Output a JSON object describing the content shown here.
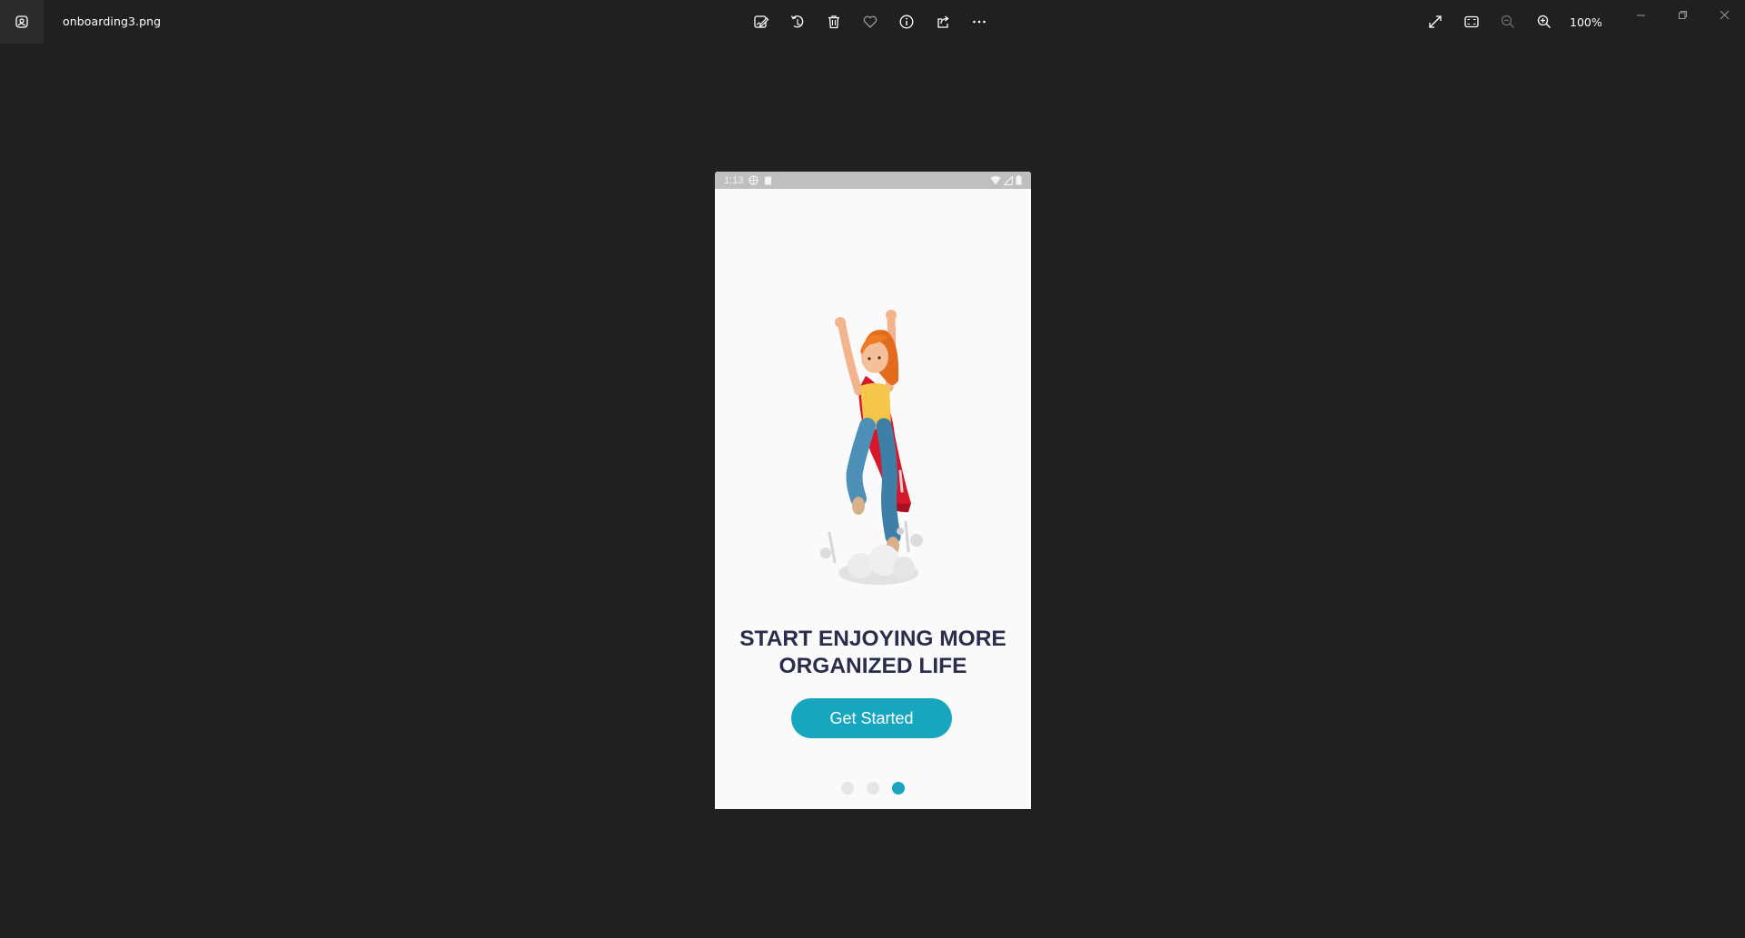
{
  "window": {
    "file_name": "onboarding3.png",
    "zoom_level": "100%"
  },
  "toolbar": {
    "center_icons": [
      "edit-image-icon",
      "rotate-icon",
      "delete-icon",
      "favorite-heart-icon",
      "info-icon",
      "share-icon",
      "more-options-icon"
    ],
    "right_icons": [
      "full-screen-icon",
      "fit-to-window-icon",
      "zoom-out-icon",
      "zoom-in-icon"
    ]
  },
  "phone": {
    "status_bar": {
      "time": "1:13"
    },
    "headline_line1": "START ENJOYING MORE",
    "headline_line2": "ORGANIZED LIFE",
    "cta_label": "Get Started",
    "pagination": {
      "total": 3,
      "active_index": 3
    }
  },
  "colors": {
    "viewer_background": "#202020",
    "accent": "#17a6be",
    "headline": "#2b2e4a",
    "inactive_dot": "#e6e6e6"
  }
}
